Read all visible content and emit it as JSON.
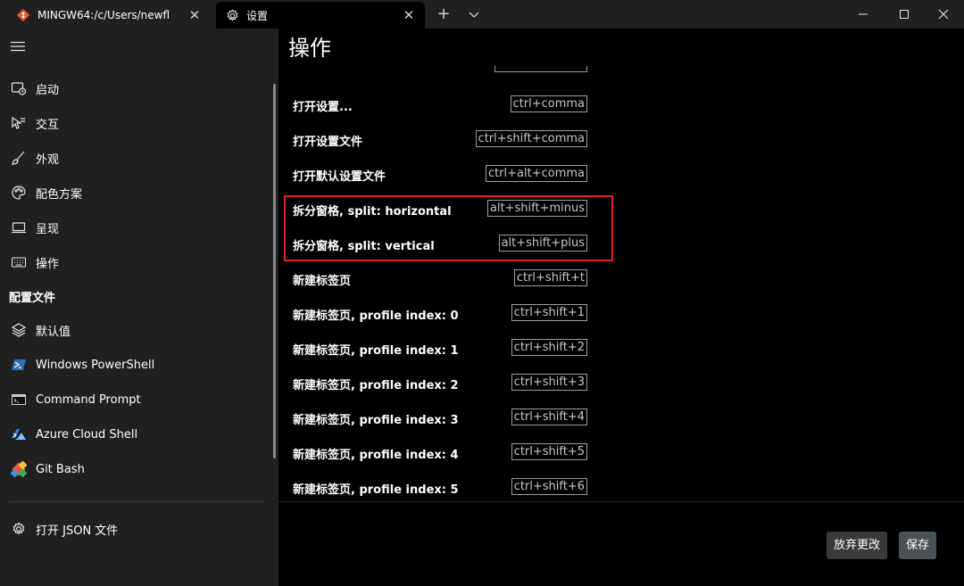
{
  "titlebar": {
    "tabs": [
      {
        "title": "MINGW64:/c/Users/newfl",
        "icon": "git-bash-icon"
      },
      {
        "title": "设置",
        "icon": "gear-icon"
      }
    ],
    "new_tab": "+"
  },
  "sidebar": {
    "items": [
      {
        "label": "启动",
        "icon": "startup-icon"
      },
      {
        "label": "交互",
        "icon": "interaction-icon"
      },
      {
        "label": "外观",
        "icon": "brush-icon"
      },
      {
        "label": "配色方案",
        "icon": "palette-icon"
      },
      {
        "label": "呈现",
        "icon": "monitor-icon"
      },
      {
        "label": "操作",
        "icon": "keyboard-icon"
      }
    ],
    "section_title": "配置文件",
    "profiles": [
      {
        "label": "默认值",
        "icon": "layers-icon"
      },
      {
        "label": "Windows PowerShell",
        "icon": "powershell-icon"
      },
      {
        "label": "Command Prompt",
        "icon": "cmd-icon"
      },
      {
        "label": "Azure Cloud Shell",
        "icon": "azure-icon"
      },
      {
        "label": "Git Bash",
        "icon": "git-bash-icon"
      }
    ],
    "open_json": {
      "label": "打开 JSON 文件",
      "icon": "gear-icon"
    },
    "selected": "操作"
  },
  "main": {
    "title": "操作",
    "bindings": [
      {
        "name": "打开设置...",
        "keys": "ctrl+comma"
      },
      {
        "name": "打开设置文件",
        "keys": "ctrl+shift+comma"
      },
      {
        "name": "打开默认设置文件",
        "keys": "ctrl+alt+comma"
      },
      {
        "name": "拆分窗格, split: horizontal",
        "keys": "alt+shift+minus"
      },
      {
        "name": "拆分窗格, split: vertical",
        "keys": "alt+shift+plus"
      },
      {
        "name": "新建标签页",
        "keys": "ctrl+shift+t"
      },
      {
        "name": "新建标签页, profile index: 0",
        "keys": "ctrl+shift+1"
      },
      {
        "name": "新建标签页, profile index: 1",
        "keys": "ctrl+shift+2"
      },
      {
        "name": "新建标签页, profile index: 2",
        "keys": "ctrl+shift+3"
      },
      {
        "name": "新建标签页, profile index: 3",
        "keys": "ctrl+shift+4"
      },
      {
        "name": "新建标签页, profile index: 4",
        "keys": "ctrl+shift+5"
      },
      {
        "name": "新建标签页, profile index: 5",
        "keys": "ctrl+shift+6"
      }
    ]
  },
  "footer": {
    "discard_label": "放弃更改",
    "save_label": "保存"
  },
  "colors": {
    "highlight": "#e0202a",
    "sidebar_bg": "#202020",
    "main_bg": "#000000"
  }
}
